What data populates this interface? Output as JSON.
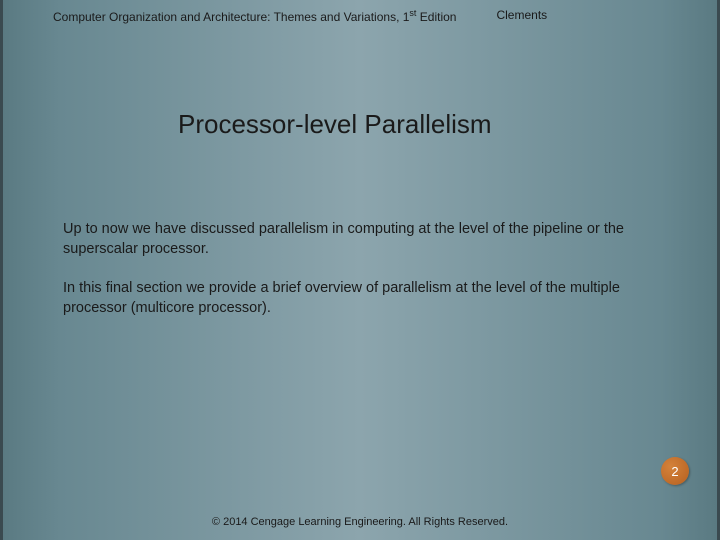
{
  "header": {
    "titlePrefix": "Computer Organization and Architecture: Themes and Variations, 1",
    "titleSuper": "st",
    "titleSuffix": " Edition",
    "author": "Clements"
  },
  "main": {
    "title": "Processor-level Parallelism",
    "paragraphs": [
      "Up to now we have discussed parallelism in computing at the level of the pipeline or the superscalar processor.",
      "In this final section we provide a brief overview of parallelism at the level of the multiple processor (multicore processor)."
    ]
  },
  "pageNumber": "2",
  "footer": "© 2014 Cengage Learning Engineering. All Rights Reserved."
}
